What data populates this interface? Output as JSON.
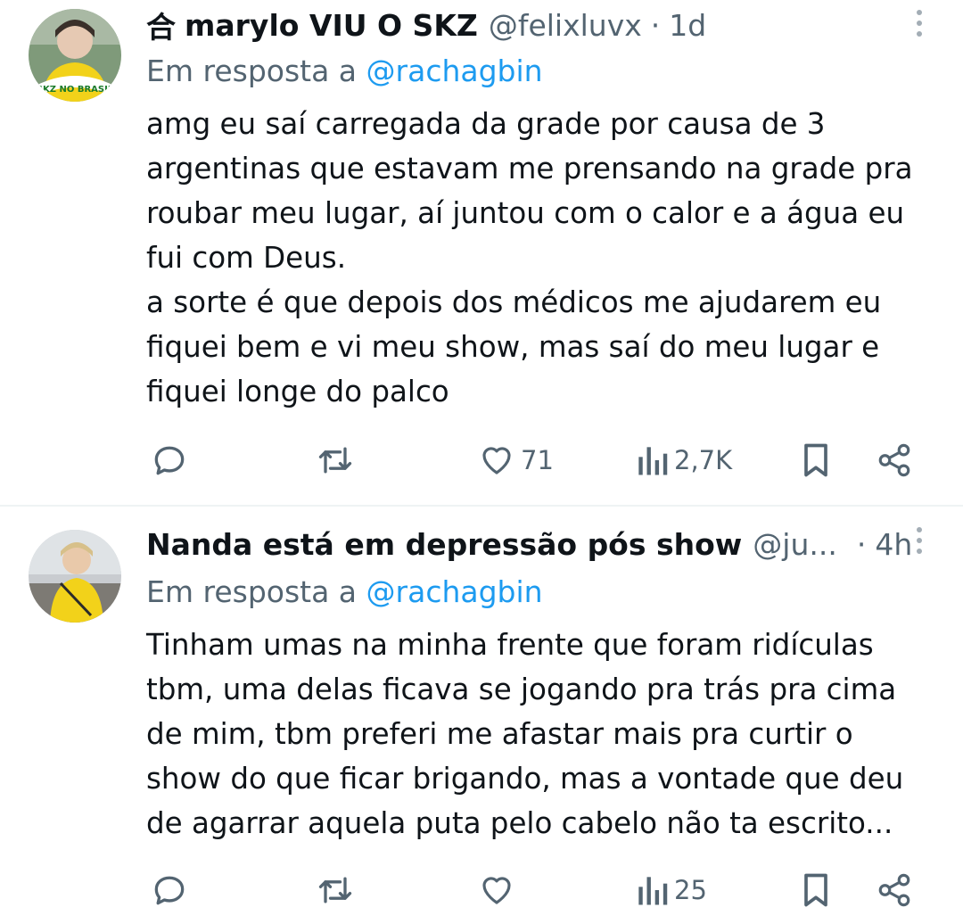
{
  "tweets": [
    {
      "name_icon": "合",
      "name": "marylo VIU O SKZ",
      "handle": "@felixluvx",
      "dot": "·",
      "time": "1d",
      "reply_prefix": "Em resposta a",
      "reply_mention": "@rachagbin",
      "avatar_text": "SKZ NO BRASIL",
      "text": "amg eu saí carregada da grade por causa de 3\nargentinas que estavam me prensando na grade pra\nroubar meu lugar, aí juntou com o calor e a água eu\nfui com Deus.\na sorte é que depois dos médicos me ajudarem eu\nfiquei bem e vi meu show, mas saí do meu lugar e\nfiquei longe do palco",
      "likes": "71",
      "views": "2,7K"
    },
    {
      "name": "Nanda está em depressão pós show",
      "handle": "@ju...",
      "dot": "·",
      "time": "4h",
      "reply_prefix": "Em resposta a",
      "reply_mention": "@rachagbin",
      "text": "Tinham umas na minha frente que foram ridículas\ntbm, uma delas ficava se jogando pra trás pra cima\nde mim, tbm preferi me afastar mais pra curtir o\nshow do que ficar brigando, mas a vontade que deu\nde agarrar aquela puta pelo cabelo não ta escrito...",
      "likes": "",
      "views": "25"
    }
  ],
  "icons": {
    "reply": "reply-icon",
    "retweet": "retweet-icon",
    "like": "heart-icon",
    "views": "views-icon",
    "bookmark": "bookmark-icon",
    "share": "share-icon",
    "more": "more-icon"
  },
  "colors": {
    "text": "#0f1419",
    "secondary": "#536471",
    "link": "#1d9bf0",
    "divider": "#eff3f4"
  }
}
